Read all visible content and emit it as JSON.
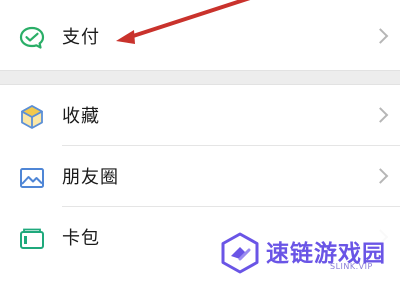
{
  "menu": {
    "payment_label": "支付",
    "favorites_label": "收藏",
    "moments_label": "朋友圈",
    "cards_label": "卡包"
  },
  "icons": {
    "payment": "payment-icon",
    "favorites": "favorites-cube-icon",
    "moments": "moments-image-icon",
    "cards": "card-wallet-icon",
    "chevron": "chevron-right-icon"
  },
  "colors": {
    "payment_icon": "#2aae67",
    "favorites_icon_fill": "#f2c84b",
    "favorites_icon_stroke": "#5b8fd6",
    "moments_icon": "#4f86d6",
    "cards_icon": "#1fa97c",
    "annotation_arrow": "#c9322c",
    "watermark": "#6a55e6"
  },
  "watermark": {
    "title": "速链游戏园",
    "subtitle": "SLINK.VIP"
  }
}
